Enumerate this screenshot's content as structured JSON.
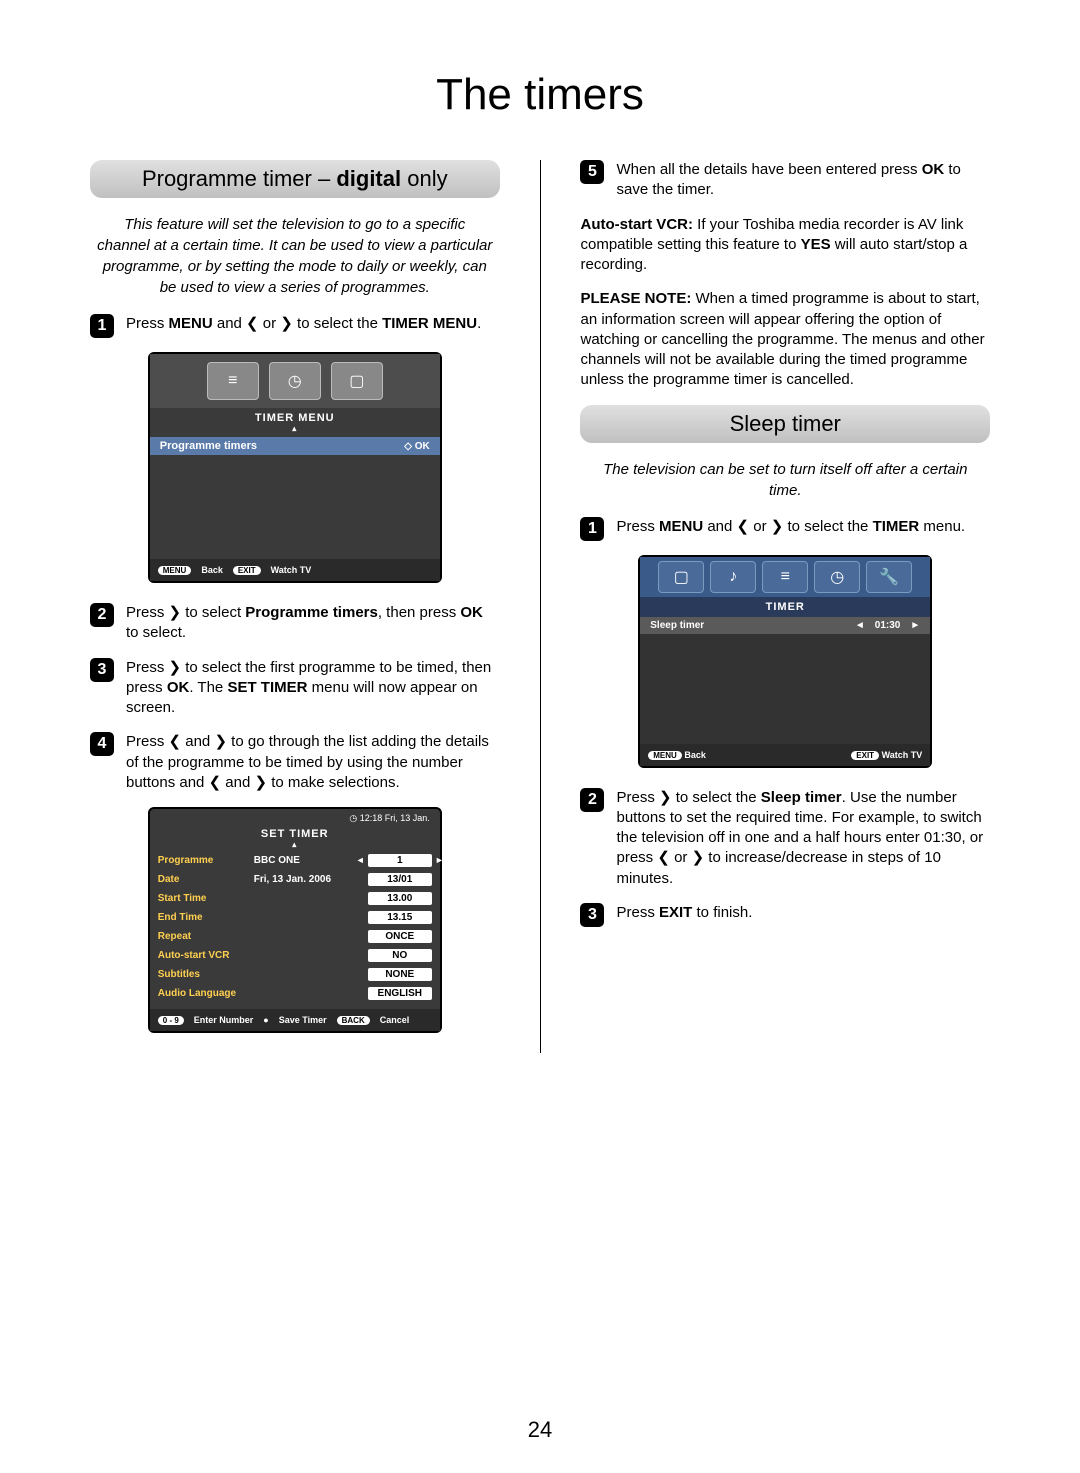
{
  "page": {
    "title": "The timers",
    "number": "24"
  },
  "left": {
    "header_prefix": "Programme timer – ",
    "header_bold": "digital",
    "header_suffix": " only",
    "intro": "This feature will set the television to go to a specific channel at a certain time. It can be used to view a particular programme, or by setting the mode to daily or weekly, can be used to view a series of programmes.",
    "step1": {
      "n": "1",
      "pre": "Press ",
      "b1": "MENU",
      "mid": " and ❮ or ❯ to select the ",
      "b2": "TIMER MENU",
      "post": "."
    },
    "osd1": {
      "title": "TIMER MENU",
      "row_label": "Programme timers",
      "row_action": "OK",
      "footer_menu": "MENU",
      "footer_back": "Back",
      "footer_exit": "EXIT",
      "footer_watch": "Watch TV"
    },
    "step2": {
      "n": "2",
      "pre": "Press ❯ to select ",
      "b1": "Programme timers",
      "mid": ", then press ",
      "b2": "OK",
      "post": " to select."
    },
    "step3": {
      "n": "3",
      "pre": "Press ❯ to select the first programme to be timed, then press ",
      "b1": "OK",
      "mid": ". The ",
      "b2": "SET TIMER",
      "post": " menu will now appear on screen."
    },
    "step4": {
      "n": "4",
      "text": "Press ❮ and ❯ to go through the list adding the details of the programme to be timed by using the number buttons and ❮ and ❯ to make selections."
    },
    "osd2": {
      "clock": "12:18 Fri, 13 Jan.",
      "title": "SET TIMER",
      "rows": [
        {
          "label": "Programme",
          "mid": "BBC ONE",
          "val": "1",
          "arrows": true
        },
        {
          "label": "Date",
          "mid": "Fri, 13 Jan. 2006",
          "val": "13/01"
        },
        {
          "label": "Start Time",
          "mid": "",
          "val": "13.00"
        },
        {
          "label": "End Time",
          "mid": "",
          "val": "13.15"
        },
        {
          "label": "Repeat",
          "mid": "",
          "val": "ONCE"
        },
        {
          "label": "Auto-start VCR",
          "mid": "",
          "val": "NO"
        },
        {
          "label": "Subtitles",
          "mid": "",
          "val": "NONE"
        },
        {
          "label": "Audio Language",
          "mid": "",
          "val": "ENGLISH"
        }
      ],
      "footer": {
        "nums": "0 - 9",
        "enter": "Enter Number",
        "save_dot": "●",
        "save": "Save Timer",
        "back": "BACK",
        "cancel": "Cancel"
      }
    }
  },
  "right": {
    "step5": {
      "n": "5",
      "pre": "When all the details have been entered press ",
      "b1": "OK",
      "post": " to save the timer."
    },
    "para1": {
      "b": "Auto-start VCR:",
      "t1": " If your Toshiba media recorder is AV link compatible setting this feature to ",
      "b2": "YES",
      "t2": " will auto start/stop a recording."
    },
    "para2": {
      "b": "PLEASE NOTE:",
      "t": " When a timed programme is about to start, an information screen will appear offering the option of watching or cancelling the programme. The menus and other channels will not be available during the timed programme unless the programme timer is cancelled."
    },
    "sleep_header": "Sleep timer",
    "sleep_intro": "The television can be set to turn itself off after a certain time.",
    "sleep_step1": {
      "n": "1",
      "pre": "Press ",
      "b1": "MENU",
      "mid": " and ❮ or ❯ to select the ",
      "b2": "TIMER",
      "post": " menu."
    },
    "osd3": {
      "title": "TIMER",
      "row_label": "Sleep timer",
      "row_val": "01:30",
      "footer_menu": "MENU",
      "footer_back": "Back",
      "footer_exit": "EXIT",
      "footer_watch": "Watch TV"
    },
    "sleep_step2": {
      "n": "2",
      "pre": "Press ❯ to select the ",
      "b1": "Sleep timer",
      "post": ". Use the number buttons to set the required time. For example, to switch the television off in one and a half hours enter 01:30, or press ❮ or ❯ to increase/decrease in steps of 10 minutes."
    },
    "sleep_step3": {
      "n": "3",
      "pre": "Press ",
      "b1": "EXIT",
      "post": " to finish."
    }
  }
}
